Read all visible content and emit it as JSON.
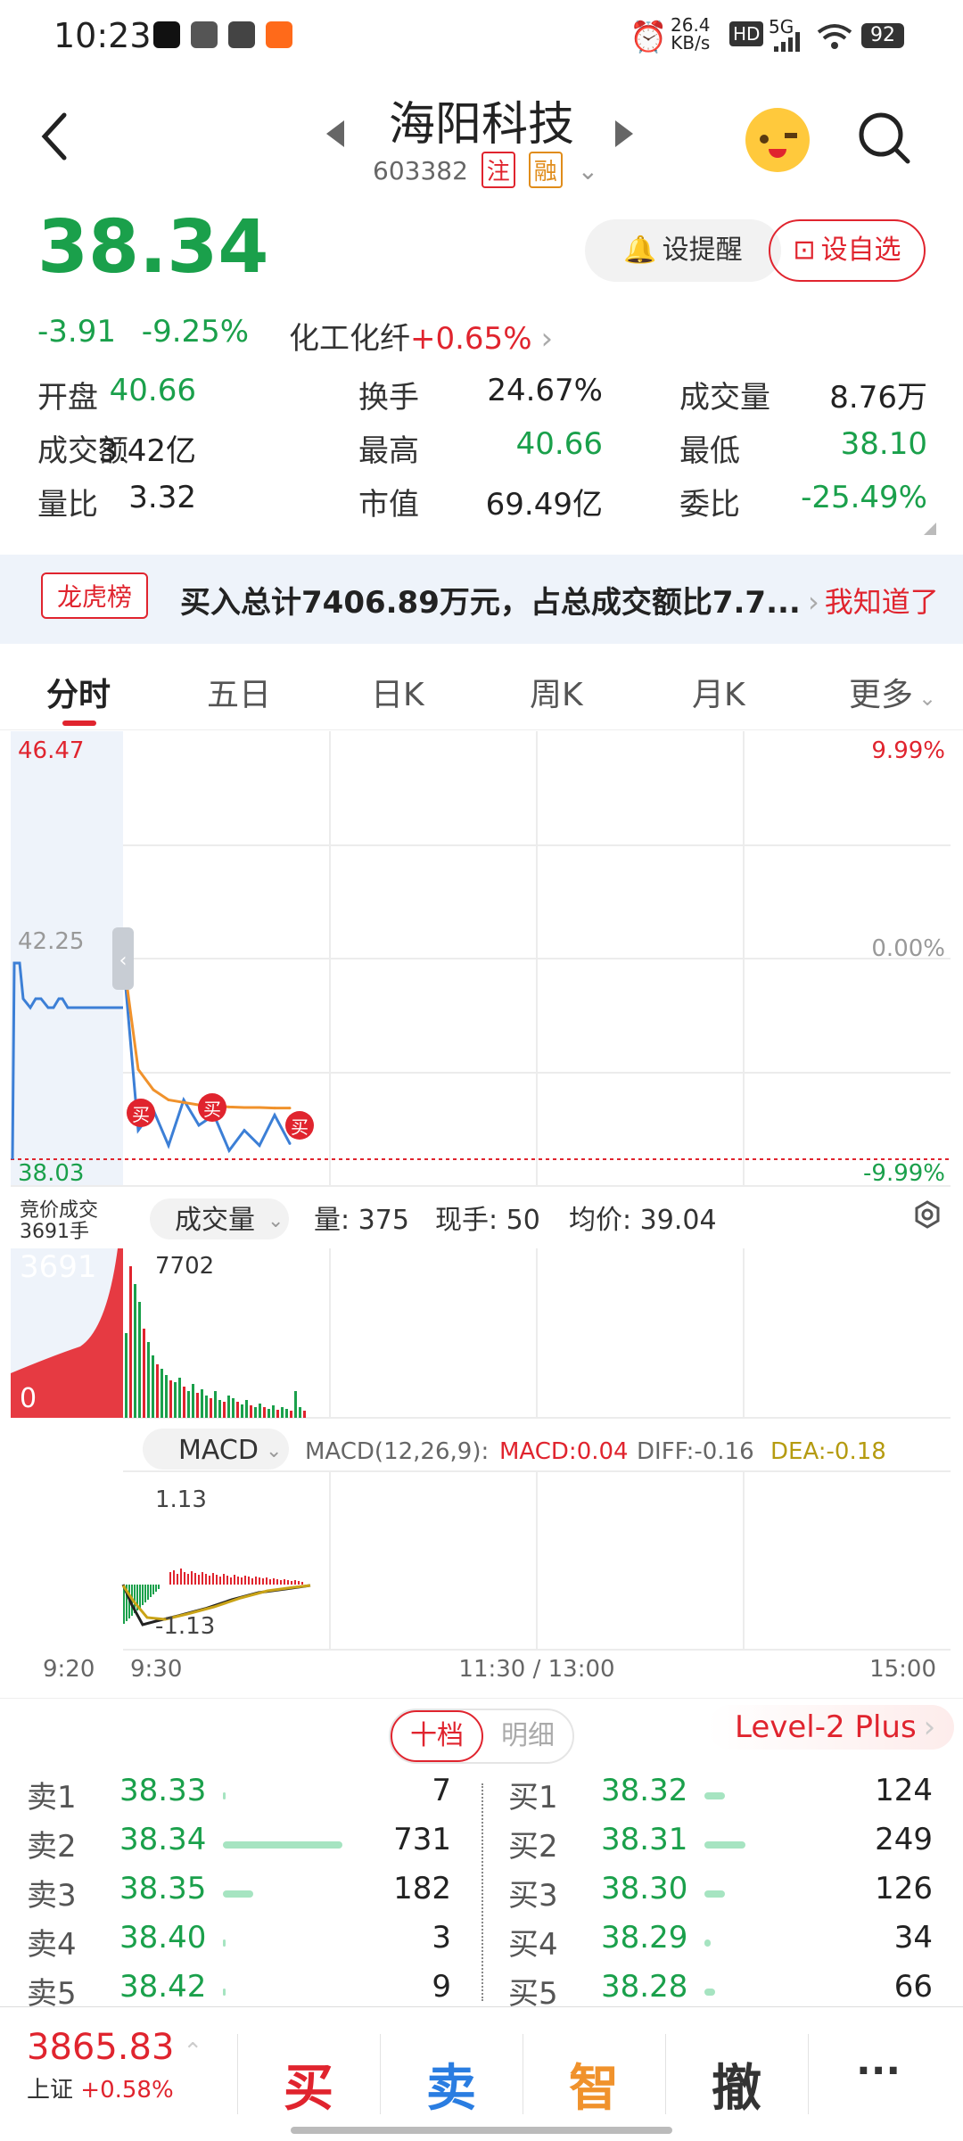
{
  "status_bar": {
    "time": "10:23",
    "speed": "26.4",
    "speed_unit": "KB/s",
    "network": "5G",
    "battery": "92"
  },
  "header": {
    "title": "海阳科技",
    "code": "603382",
    "tag1": "注",
    "tag2": "融"
  },
  "quote": {
    "price": "38.34",
    "change": "-3.91",
    "change_pct": "-9.25%",
    "sector": "化工化纤",
    "sector_change": "+0.65%",
    "remind_label": "设提醒",
    "fav_label": "设自选"
  },
  "stats": [
    {
      "label": "开盘",
      "value": "40.66"
    },
    {
      "label": "换手",
      "value": "24.67%"
    },
    {
      "label": "成交量",
      "value": "8.76万"
    },
    {
      "label": "成交额",
      "value": "3.42亿"
    },
    {
      "label": "最高",
      "value": "40.66"
    },
    {
      "label": "最低",
      "value": "38.10"
    },
    {
      "label": "量比",
      "value": "3.32"
    },
    {
      "label": "市值",
      "value": "69.49亿"
    },
    {
      "label": "委比",
      "value": "-25.49%"
    }
  ],
  "banner": {
    "tag": "龙虎榜",
    "text": "买入总计7406.89万元，占总成交额比7.7...",
    "action": "我知道了"
  },
  "tabs": [
    "分时",
    "五日",
    "日K",
    "周K",
    "月K",
    "更多"
  ],
  "chart": {
    "price_high": "46.47",
    "price_mid": "42.25",
    "price_low": "38.03",
    "pct_high": "9.99%",
    "pct_mid": "0.00%",
    "pct_low": "-9.99%",
    "buy_label": "买",
    "auction_label": "竞价成交",
    "auction_vol": "3691手",
    "vol_selector": "成交量",
    "vol_now": "量: 375",
    "hand_now": "现手: 50",
    "avg_price": "均价: 39.04",
    "vol_max_left": "3691",
    "vol_max": "7702",
    "vol_zero": "0",
    "macd_selector": "MACD",
    "macd_params": "MACD(12,26,9):",
    "macd_val": "MACD:0.04",
    "diff_val": "DIFF:-0.16",
    "dea_val": "DEA:-0.18",
    "macd_top": "1.13",
    "macd_bottom": "-1.13",
    "time_labels": [
      "9:20",
      "9:30",
      "11:30 / 13:00",
      "15:00"
    ]
  },
  "chart_data": {
    "type": "line",
    "title": "",
    "x": [
      "9:30",
      "9:35",
      "9:40",
      "9:45",
      "9:50",
      "9:55",
      "10:00",
      "10:05",
      "10:10",
      "10:15",
      "10:20",
      "10:23"
    ],
    "series": [
      {
        "name": "",
        "values": [
          42.03,
          38.6,
          39.0,
          38.3,
          39.2,
          38.7,
          38.9,
          38.2,
          38.6,
          38.3,
          38.9,
          38.34
        ]
      },
      {
        "name": "",
        "values": [
          42.03,
          39.8,
          39.4,
          39.2,
          39.15,
          39.1,
          39.08,
          39.06,
          39.05,
          39.05,
          39.04,
          39.04
        ]
      }
    ],
    "ylim": [
      38.03,
      46.47
    ]
  },
  "order_book": {
    "mode_tabs": [
      "十档",
      "明细"
    ],
    "level2": "Level-2 Plus",
    "sells": [
      {
        "label": "卖1",
        "price": "38.33",
        "vol": "7",
        "ratio": 0.01
      },
      {
        "label": "卖2",
        "price": "38.34",
        "vol": "731",
        "ratio": 1.0
      },
      {
        "label": "卖3",
        "price": "38.35",
        "vol": "182",
        "ratio": 0.25
      },
      {
        "label": "卖4",
        "price": "38.40",
        "vol": "3",
        "ratio": 0.005
      },
      {
        "label": "卖5",
        "price": "38.42",
        "vol": "9",
        "ratio": 0.012
      }
    ],
    "buys": [
      {
        "label": "买1",
        "price": "38.32",
        "vol": "124",
        "ratio": 0.17
      },
      {
        "label": "买2",
        "price": "38.31",
        "vol": "249",
        "ratio": 0.34
      },
      {
        "label": "买3",
        "price": "38.30",
        "vol": "126",
        "ratio": 0.17
      },
      {
        "label": "买4",
        "price": "38.29",
        "vol": "34",
        "ratio": 0.05
      },
      {
        "label": "买5",
        "price": "38.28",
        "vol": "66",
        "ratio": 0.09
      }
    ]
  },
  "bottom_bar": {
    "index_value": "3865.83",
    "index_name": "上证",
    "index_change": "+0.58%",
    "buy": "买",
    "sell": "卖",
    "smart": "智",
    "cancel": "撤",
    "more": "···"
  },
  "colors": {
    "up": "#e0242e",
    "down": "#1aa04b",
    "price_line": "#3c7fd6",
    "avg_line": "#f0922c"
  }
}
